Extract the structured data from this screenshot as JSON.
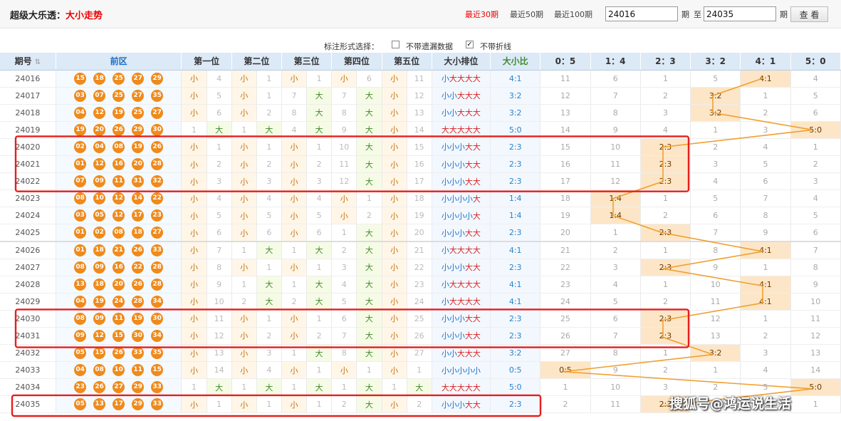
{
  "header": {
    "title": "超级大乐透：",
    "title_sub": "大小走势",
    "periods": [
      "最近30期",
      "最近50期",
      "最近100期"
    ],
    "from_value": "24016",
    "label_qi": "期",
    "label_to": "至",
    "to_value": "24035",
    "view_label": "查 看"
  },
  "options": {
    "label": "标注形式选择：",
    "miss_label": "不带遗漏数据",
    "line_label": "不带折线",
    "miss_checked": false,
    "line_checked": true
  },
  "columns": {
    "period": "期号",
    "front": "前区",
    "positions": [
      "第一位",
      "第二位",
      "第三位",
      "第四位",
      "第五位"
    ],
    "pattern": "大小排位",
    "ratio": "大小比",
    "dists": [
      "0：5",
      "1：4",
      "2：3",
      "3：2",
      "4：1",
      "5：0"
    ]
  },
  "labels": {
    "small": "小",
    "big": "大"
  },
  "rows": [
    {
      "period": "24016",
      "balls": [
        "15",
        "18",
        "25",
        "27",
        "29"
      ],
      "pos": [
        [
          "S",
          4
        ],
        [
          "S",
          1
        ],
        [
          "S",
          1
        ],
        [
          "S",
          6
        ],
        [
          "S",
          11
        ]
      ],
      "pattern": "小大大大大",
      "ratio": "4:1",
      "dists": [
        "11",
        "6",
        "1",
        "5",
        "4:1",
        "4"
      ]
    },
    {
      "period": "24017",
      "balls": [
        "03",
        "07",
        "25",
        "27",
        "35"
      ],
      "pos": [
        [
          "S",
          5
        ],
        [
          "S",
          1
        ],
        [
          "B",
          7
        ],
        [
          "B",
          7
        ],
        [
          "S",
          12
        ]
      ],
      "pattern": "小小大大大",
      "ratio": "3:2",
      "dists": [
        "12",
        "7",
        "2",
        "3:2",
        "1",
        "5"
      ]
    },
    {
      "period": "24018",
      "balls": [
        "04",
        "12",
        "19",
        "25",
        "27"
      ],
      "pos": [
        [
          "S",
          6
        ],
        [
          "S",
          2
        ],
        [
          "B",
          8
        ],
        [
          "B",
          8
        ],
        [
          "S",
          13
        ]
      ],
      "pattern": "小小大大大",
      "ratio": "3:2",
      "dists": [
        "13",
        "8",
        "3",
        "3:2",
        "2",
        "6"
      ]
    },
    {
      "period": "24019",
      "balls": [
        "19",
        "20",
        "26",
        "29",
        "30"
      ],
      "pos": [
        [
          "B",
          1
        ],
        [
          "B",
          1
        ],
        [
          "B",
          4
        ],
        [
          "B",
          9
        ],
        [
          "S",
          14
        ]
      ],
      "pattern": "大大大大大",
      "ratio": "5:0",
      "dists": [
        "14",
        "9",
        "4",
        "1",
        "3",
        "5:0"
      ]
    },
    {
      "period": "24020",
      "balls": [
        "02",
        "04",
        "08",
        "19",
        "26"
      ],
      "pos": [
        [
          "S",
          1
        ],
        [
          "S",
          1
        ],
        [
          "S",
          1
        ],
        [
          "B",
          10
        ],
        [
          "S",
          15
        ]
      ],
      "pattern": "小小小大大",
      "ratio": "2:3",
      "dists": [
        "15",
        "10",
        "2:3",
        "2",
        "4",
        "1"
      ]
    },
    {
      "period": "24021",
      "balls": [
        "01",
        "12",
        "16",
        "20",
        "28"
      ],
      "pos": [
        [
          "S",
          2
        ],
        [
          "S",
          2
        ],
        [
          "S",
          2
        ],
        [
          "B",
          11
        ],
        [
          "S",
          16
        ]
      ],
      "pattern": "小小小大大",
      "ratio": "2:3",
      "dists": [
        "16",
        "11",
        "2:3",
        "3",
        "5",
        "2"
      ]
    },
    {
      "period": "24022",
      "balls": [
        "07",
        "09",
        "11",
        "31",
        "32"
      ],
      "pos": [
        [
          "S",
          3
        ],
        [
          "S",
          3
        ],
        [
          "S",
          3
        ],
        [
          "B",
          12
        ],
        [
          "S",
          17
        ]
      ],
      "pattern": "小小小大大",
      "ratio": "2:3",
      "dists": [
        "17",
        "12",
        "2:3",
        "4",
        "6",
        "3"
      ]
    },
    {
      "period": "24023",
      "balls": [
        "08",
        "10",
        "12",
        "14",
        "22"
      ],
      "pos": [
        [
          "S",
          4
        ],
        [
          "S",
          4
        ],
        [
          "S",
          4
        ],
        [
          "S",
          1
        ],
        [
          "S",
          18
        ]
      ],
      "pattern": "小小小小大",
      "ratio": "1:4",
      "dists": [
        "18",
        "1:4",
        "1",
        "5",
        "7",
        "4"
      ]
    },
    {
      "period": "24024",
      "balls": [
        "03",
        "05",
        "12",
        "17",
        "23"
      ],
      "pos": [
        [
          "S",
          5
        ],
        [
          "S",
          5
        ],
        [
          "S",
          5
        ],
        [
          "S",
          2
        ],
        [
          "S",
          19
        ]
      ],
      "pattern": "小小小小大",
      "ratio": "1:4",
      "dists": [
        "19",
        "1:4",
        "2",
        "6",
        "8",
        "5"
      ]
    },
    {
      "period": "24025",
      "balls": [
        "01",
        "02",
        "08",
        "18",
        "27"
      ],
      "pos": [
        [
          "S",
          6
        ],
        [
          "S",
          6
        ],
        [
          "S",
          6
        ],
        [
          "B",
          1
        ],
        [
          "S",
          20
        ]
      ],
      "pattern": "小小小大大",
      "ratio": "2:3",
      "dists": [
        "20",
        "1",
        "2:3",
        "7",
        "9",
        "6"
      ]
    },
    {
      "period": "24026",
      "balls": [
        "01",
        "18",
        "21",
        "26",
        "33"
      ],
      "pos": [
        [
          "S",
          7
        ],
        [
          "B",
          1
        ],
        [
          "B",
          1
        ],
        [
          "B",
          2
        ],
        [
          "S",
          21
        ]
      ],
      "pattern": "小大大大大",
      "ratio": "4:1",
      "dists": [
        "21",
        "2",
        "1",
        "8",
        "4:1",
        "7"
      ]
    },
    {
      "period": "24027",
      "balls": [
        "08",
        "09",
        "16",
        "22",
        "28"
      ],
      "pos": [
        [
          "S",
          8
        ],
        [
          "S",
          1
        ],
        [
          "S",
          1
        ],
        [
          "B",
          3
        ],
        [
          "S",
          22
        ]
      ],
      "pattern": "小小小大大",
      "ratio": "2:3",
      "dists": [
        "22",
        "3",
        "2:3",
        "9",
        "1",
        "8"
      ]
    },
    {
      "period": "24028",
      "balls": [
        "13",
        "18",
        "20",
        "26",
        "28"
      ],
      "pos": [
        [
          "S",
          9
        ],
        [
          "B",
          1
        ],
        [
          "B",
          1
        ],
        [
          "B",
          4
        ],
        [
          "S",
          23
        ]
      ],
      "pattern": "小大大大大",
      "ratio": "4:1",
      "dists": [
        "23",
        "4",
        "1",
        "10",
        "4:1",
        "9"
      ]
    },
    {
      "period": "24029",
      "balls": [
        "04",
        "19",
        "24",
        "28",
        "34"
      ],
      "pos": [
        [
          "S",
          10
        ],
        [
          "B",
          2
        ],
        [
          "B",
          2
        ],
        [
          "B",
          5
        ],
        [
          "S",
          24
        ]
      ],
      "pattern": "小大大大大",
      "ratio": "4:1",
      "dists": [
        "24",
        "5",
        "2",
        "11",
        "4:1",
        "10"
      ]
    },
    {
      "period": "24030",
      "balls": [
        "08",
        "09",
        "11",
        "19",
        "30"
      ],
      "pos": [
        [
          "S",
          11
        ],
        [
          "S",
          1
        ],
        [
          "S",
          1
        ],
        [
          "B",
          6
        ],
        [
          "S",
          25
        ]
      ],
      "pattern": "小小小大大",
      "ratio": "2:3",
      "dists": [
        "25",
        "6",
        "2:3",
        "12",
        "1",
        "11"
      ]
    },
    {
      "period": "24031",
      "balls": [
        "09",
        "12",
        "15",
        "30",
        "34"
      ],
      "pos": [
        [
          "S",
          12
        ],
        [
          "S",
          2
        ],
        [
          "S",
          2
        ],
        [
          "B",
          7
        ],
        [
          "S",
          26
        ]
      ],
      "pattern": "小小小大大",
      "ratio": "2:3",
      "dists": [
        "26",
        "7",
        "2:3",
        "13",
        "2",
        "12"
      ]
    },
    {
      "period": "24032",
      "balls": [
        "05",
        "15",
        "26",
        "33",
        "35"
      ],
      "pos": [
        [
          "S",
          13
        ],
        [
          "S",
          3
        ],
        [
          "B",
          1
        ],
        [
          "B",
          8
        ],
        [
          "S",
          27
        ]
      ],
      "pattern": "小小大大大",
      "ratio": "3:2",
      "dists": [
        "27",
        "8",
        "1",
        "3:2",
        "3",
        "13"
      ]
    },
    {
      "period": "24033",
      "balls": [
        "04",
        "08",
        "10",
        "11",
        "15"
      ],
      "pos": [
        [
          "S",
          14
        ],
        [
          "S",
          4
        ],
        [
          "S",
          1
        ],
        [
          "S",
          1
        ],
        [
          "S",
          1
        ]
      ],
      "pattern": "小小小小小",
      "ratio": "0:5",
      "dists": [
        "0:5",
        "9",
        "2",
        "1",
        "4",
        "14"
      ]
    },
    {
      "period": "24034",
      "balls": [
        "23",
        "26",
        "27",
        "29",
        "33"
      ],
      "pos": [
        [
          "B",
          1
        ],
        [
          "B",
          1
        ],
        [
          "B",
          1
        ],
        [
          "B",
          1
        ],
        [
          "B",
          1
        ]
      ],
      "pattern": "大大大大大",
      "ratio": "5:0",
      "dists": [
        "1",
        "10",
        "3",
        "2",
        "5",
        "5:0"
      ]
    },
    {
      "period": "24035",
      "balls": [
        "05",
        "13",
        "17",
        "29",
        "33"
      ],
      "pos": [
        [
          "S",
          1
        ],
        [
          "S",
          1
        ],
        [
          "S",
          1
        ],
        [
          "B",
          2
        ],
        [
          "S",
          2
        ]
      ],
      "pattern": "小小小大大",
      "ratio": "2:3",
      "dists": [
        "2",
        "11",
        "2:3",
        "3",
        "6",
        "1"
      ]
    }
  ],
  "watermark": "搜狐号@鸿运说生活",
  "colors": {
    "ball": "#f08a1b",
    "small": "#1b6fc4",
    "big": "#d62020",
    "highlight": "#e61e1e",
    "trend_line": "#f0a030"
  }
}
